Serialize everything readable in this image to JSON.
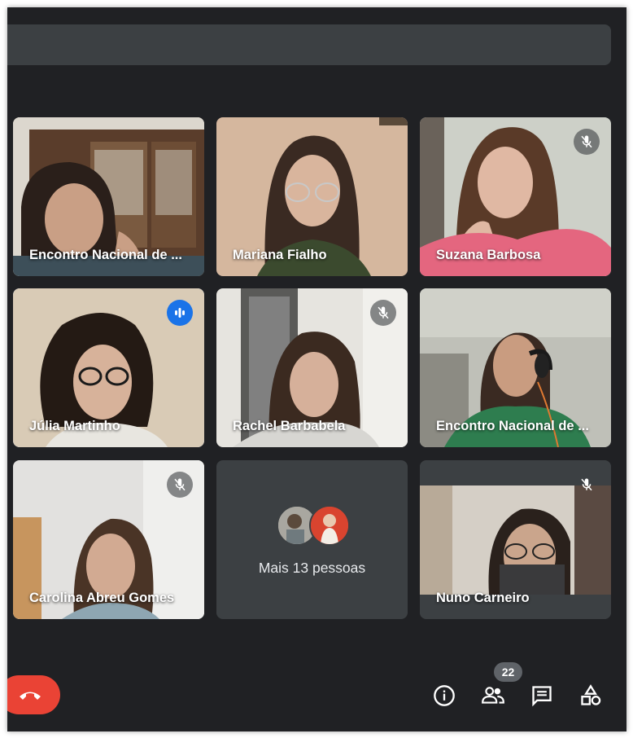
{
  "participants": [
    {
      "name": "Encontro Nacional de ..."
    },
    {
      "name": "Mariana Fialho"
    },
    {
      "name": "Suzana Barbosa"
    },
    {
      "name": "Júlia Martinho"
    },
    {
      "name": "Rachel Barbabela"
    },
    {
      "name": "Encontro Nacional de ..."
    },
    {
      "name": "Carolina Abreu Gomes"
    },
    {
      "name": "Nuno Carneiro"
    }
  ],
  "more_people": {
    "label": "Mais 13 pessoas"
  },
  "controls": {
    "people_count": "22"
  },
  "icons": {
    "muted": "mic-off-icon",
    "speaking": "speaking-icon",
    "end_call": "phone-hangup-icon",
    "info": "info-icon",
    "people": "people-icon",
    "chat": "chat-icon",
    "activities": "shapes-icon"
  },
  "colors": {
    "background": "#202124",
    "tile": "#3c4043",
    "accent": "#1a73e8",
    "active_border": "#8ab4f8",
    "end_call": "#ea4335"
  }
}
